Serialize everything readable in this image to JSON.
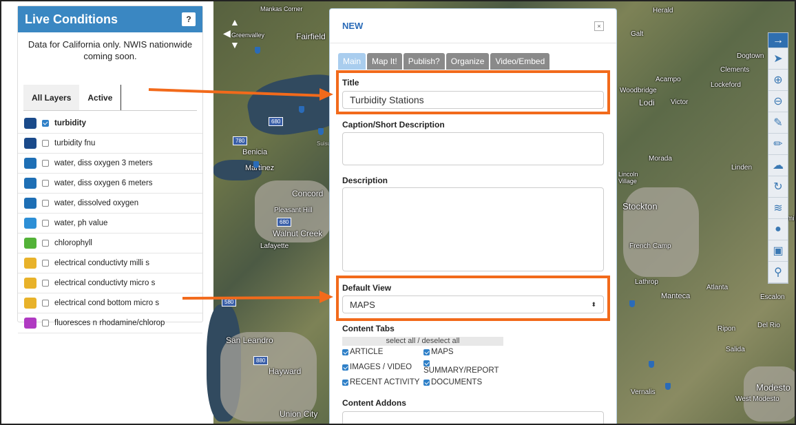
{
  "panel": {
    "title": "Live Conditions",
    "help": "?",
    "note": "Data for California only. NWIS nationwide coming soon.",
    "tabs": [
      "All Layers",
      "Active"
    ],
    "layers": [
      {
        "label": "turbidity",
        "checked": true,
        "icon": "turbidity-icon",
        "bold": true
      },
      {
        "label": "turbidity fnu",
        "checked": false,
        "icon": "turbidity-icon"
      },
      {
        "label": "water, diss oxygen 3 meters",
        "checked": false,
        "icon": "oxygen-icon"
      },
      {
        "label": "water, diss oxygen 6 meters",
        "checked": false,
        "icon": "oxygen-icon"
      },
      {
        "label": "water, dissolved oxygen",
        "checked": false,
        "icon": "oxygen-icon"
      },
      {
        "label": "water, ph value",
        "checked": false,
        "icon": "ph-icon"
      },
      {
        "label": "chlorophyll",
        "checked": false,
        "icon": "leaf-icon"
      },
      {
        "label": "electrical conductivty milli s",
        "checked": false,
        "icon": "conductivity-icon"
      },
      {
        "label": "electrical conductivty micro s",
        "checked": false,
        "icon": "conductivity-icon"
      },
      {
        "label": "electrical cond bottom micro s",
        "checked": false,
        "icon": "conductivity-icon"
      },
      {
        "label": "fluoresces n rhodamine/chlorop",
        "checked": false,
        "icon": "fluorescence-icon"
      }
    ]
  },
  "map": {
    "labels": [
      "Mankas Corner",
      "Fairfield",
      "Benicia",
      "Martinez",
      "Concord",
      "Pleasant Hill",
      "Walnut Creek",
      "Lafayette",
      "San Leandro",
      "Hayward",
      "Union City",
      "Suisun Bay",
      "Herald",
      "Galt",
      "Acampo",
      "Lockeford",
      "Woodbridge",
      "Lodi",
      "Victor",
      "Dogtown",
      "Clements",
      "Stockton",
      "Morada",
      "Linden",
      "French Camp",
      "Lathrop",
      "Manteca",
      "Atlanta",
      "Escalon",
      "Ripon",
      "Salida",
      "Del Rio",
      "Vernalis",
      "Modesto",
      "West Modesto",
      "Farmington",
      "Lincoln Village",
      "Greenvalley"
    ],
    "highways": [
      "680",
      "780",
      "680",
      "580",
      "880"
    ]
  },
  "modal": {
    "title": "NEW",
    "close": "×",
    "tabs": [
      "Main",
      "Map It!",
      "Publish?",
      "Organize",
      "Video/Embed"
    ],
    "title_label": "Title",
    "title_value": "Turbidity Stations",
    "caption_label": "Caption/Short Description",
    "description_label": "Description",
    "default_view_label": "Default View",
    "default_view_value": "MAPS",
    "content_tabs_label": "Content Tabs",
    "select_all": "select all / deselect all",
    "content_tabs": [
      {
        "label": "ARTICLE",
        "checked": true
      },
      {
        "label": "MAPS",
        "checked": true
      },
      {
        "label": "IMAGES / VIDEO",
        "checked": true
      },
      {
        "label": "SUMMARY/REPORT",
        "checked": true
      },
      {
        "label": "RECENT ACTIVITY",
        "checked": true
      },
      {
        "label": "DOCUMENTS",
        "checked": true
      }
    ],
    "content_addons_label": "Content Addons"
  },
  "colors": {
    "accent": "#3a87c2",
    "highlight": "#f26a1b",
    "tab_active": "#a9cdee"
  }
}
